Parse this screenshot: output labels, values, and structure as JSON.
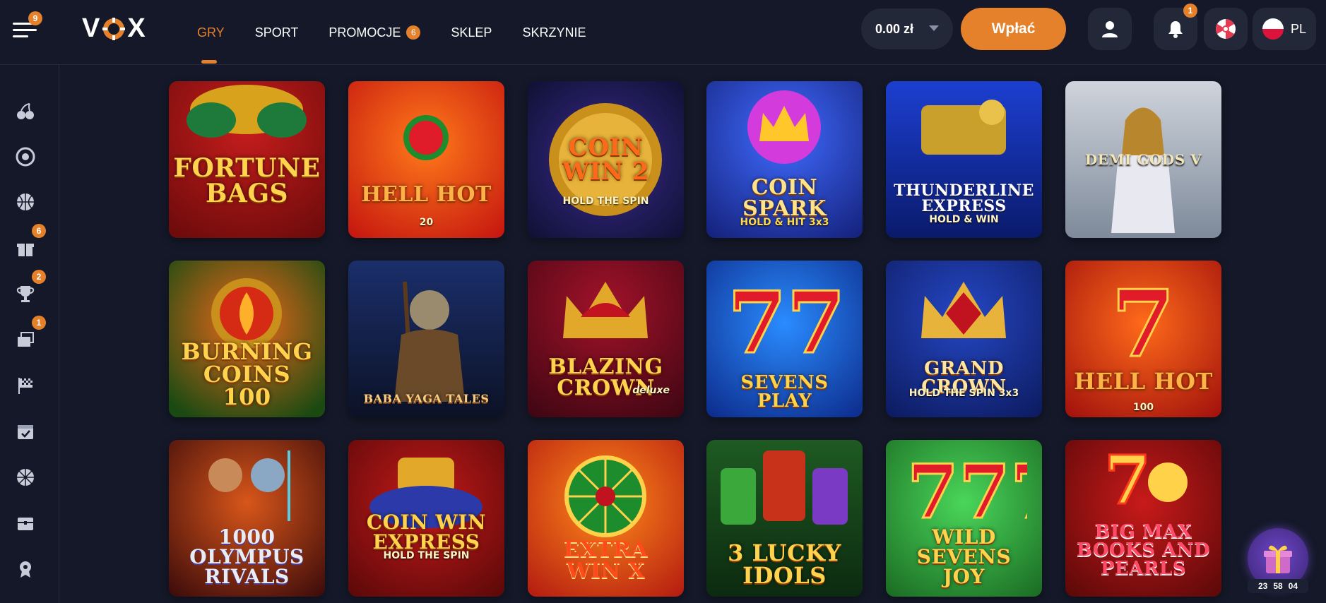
{
  "header": {
    "menu_badge": "9",
    "logo_text": "VOX",
    "nav": [
      {
        "label": "GRY",
        "active": true
      },
      {
        "label": "SPORT"
      },
      {
        "label": "PROMOCJE",
        "badge": "6"
      },
      {
        "label": "SKLEP"
      },
      {
        "label": "SKRZYNIE"
      }
    ],
    "balance": "0.00 zł",
    "deposit_label": "Wpłać",
    "notifications_badge": "1",
    "language": "PL"
  },
  "sidebar": {
    "items": [
      {
        "icon": "cherries-icon"
      },
      {
        "icon": "live-casino-chip-icon"
      },
      {
        "icon": "basketball-icon"
      },
      {
        "icon": "gift-icon",
        "badge": "6"
      },
      {
        "icon": "trophy-icon",
        "badge": "2"
      },
      {
        "icon": "tickets-icon",
        "badge": "1"
      },
      {
        "icon": "checkered-flag-icon"
      },
      {
        "icon": "calendar-check-icon"
      },
      {
        "icon": "wheel-icon"
      },
      {
        "icon": "treasure-chest-icon"
      },
      {
        "icon": "badge-icon"
      }
    ]
  },
  "games": [
    {
      "title": "FORTUNE BAGS",
      "subtitle": ""
    },
    {
      "title": "HELL HOT",
      "subtitle": "20"
    },
    {
      "title": "COIN WIN 2",
      "subtitle": "HOLD THE SPIN"
    },
    {
      "title": "COIN SPARK",
      "subtitle": "HOLD & HIT 3x3"
    },
    {
      "title": "THUNDERLINE EXPRESS",
      "subtitle": "HOLD & WIN"
    },
    {
      "title": "DEMI GODS V",
      "subtitle": ""
    },
    {
      "title": "BURNING COINS 100",
      "subtitle": ""
    },
    {
      "title": "BABA YAGA TALES",
      "subtitle": ""
    },
    {
      "title": "BLAZING CROWN",
      "subtitle": "deluxe"
    },
    {
      "title": "SEVENS PLAY",
      "subtitle": ""
    },
    {
      "title": "GRAND CROWN",
      "subtitle": "HOLD THE SPIN 3x3"
    },
    {
      "title": "HELL HOT",
      "subtitle": "100"
    },
    {
      "title": "1000 OLYMPUS RIVALS",
      "subtitle": ""
    },
    {
      "title": "COIN WIN EXPRESS",
      "subtitle": "HOLD THE SPIN"
    },
    {
      "title": "EXTRA WIN X",
      "subtitle": ""
    },
    {
      "title": "3 LUCKY IDOLS",
      "subtitle": ""
    },
    {
      "title": "WILD SEVENS JOY",
      "subtitle": ""
    },
    {
      "title": "BIG MAX BOOKS AND PEARLS",
      "subtitle": ""
    }
  ],
  "gift_timer": {
    "h": "23",
    "m": "58",
    "s": "04"
  },
  "colors": {
    "accent": "#e5812b",
    "background": "#141828",
    "panel": "#232839"
  }
}
